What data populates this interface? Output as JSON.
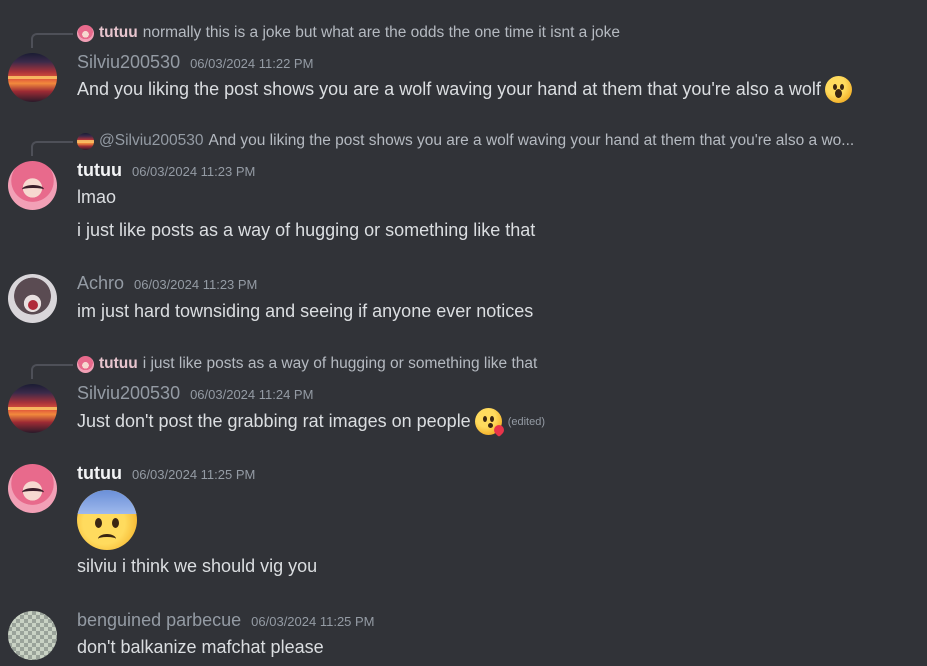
{
  "messages": [
    {
      "reply": {
        "name": "tutuu",
        "text": "normally this is a joke but what are the odds the one time it isnt a joke"
      },
      "author": "Silviu200530",
      "timestamp": "06/03/2024 11:22 PM",
      "lines": [
        "And you liking the post shows you are a wolf waving your hand at them that you're also a wolf"
      ],
      "emoji": "hushed-face-emoji"
    },
    {
      "reply": {
        "mention": "@Silviu200530",
        "text": "And you liking the post shows you are a wolf waving your hand at them that you're also a wo..."
      },
      "author": "tutuu",
      "timestamp": "06/03/2024 11:23 PM",
      "lines": [
        "lmao",
        "i just like posts as a way of hugging or something like that"
      ]
    },
    {
      "author": "Achro",
      "timestamp": "06/03/2024 11:23 PM",
      "lines": [
        "im just hard townsiding and seeing if anyone ever notices"
      ]
    },
    {
      "reply": {
        "name": "tutuu",
        "text": "i just like posts as a way of hugging or something like that"
      },
      "author": "Silviu200530",
      "timestamp": "06/03/2024 11:24 PM",
      "lines": [
        "Just don't post the grabbing rat images on people"
      ],
      "emoji": "kissing-face-emoji",
      "edited": "(edited)"
    },
    {
      "author": "tutuu",
      "timestamp": "06/03/2024 11:25 PM",
      "big_emoji": "anxious-face-emoji",
      "lines": [
        "silviu i think we should vig you"
      ]
    },
    {
      "author": "benguined parbecue",
      "timestamp": "06/03/2024 11:25 PM",
      "lines": [
        "don't balkanize mafchat please"
      ]
    }
  ],
  "colors": {
    "background": "#313338",
    "text": "#dbdee1",
    "muted": "#949ba4",
    "name_bold": "#f2f3f5"
  }
}
